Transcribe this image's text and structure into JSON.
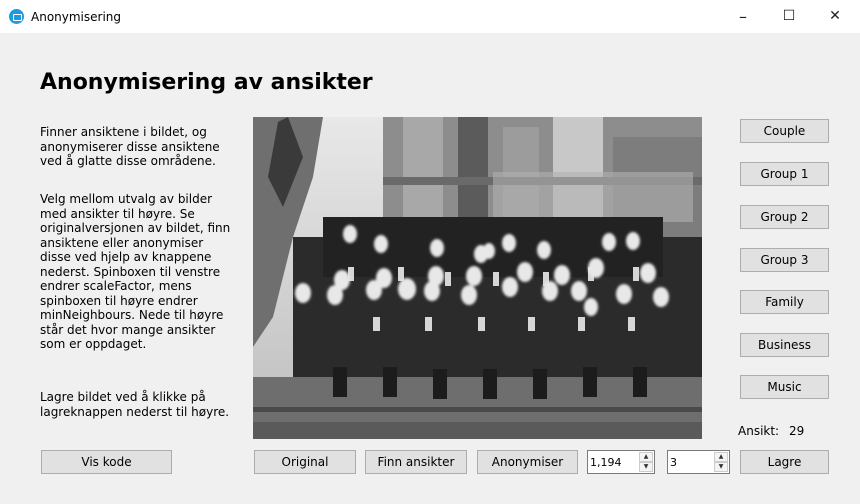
{
  "window": {
    "title": "Anonymisering",
    "minimize": "–",
    "maximize": "☐",
    "close": "✕"
  },
  "heading": "Anonymisering av ansikter",
  "description": [
    "Finner ansiktene i bildet, og anonymiserer disse ansiktene ved å glatte disse områdene.",
    "Velg mellom utvalg av bilder med ansikter til høyre. Se originalversjonen av bildet, finn ansiktene eller anonymiser disse ved hjelp av knappene nederst. Spinboxen til venstre endrer scaleFactor, mens spinboxen til høyre endrer minNeighbours. Nede til høyre står det hvor mange ansikter som er oppdaget.",
    "Lagre bildet ved å klikke på lagreknappen nederst til høyre."
  ],
  "image_buttons": [
    "Couple",
    "Group 1",
    "Group 2",
    "Group 3",
    "Family",
    "Business",
    "Music"
  ],
  "bottom": {
    "show_code": "Vis kode",
    "original": "Original",
    "find_faces": "Finn ansikter",
    "anonymize": "Anonymiser",
    "scale_factor": "1,194",
    "min_neighbours": "3",
    "save": "Lagre"
  },
  "faces": {
    "label": "Ansikt:",
    "count": "29"
  },
  "colors": {
    "window_bg": "#f0f0f0",
    "button_bg": "#e1e1e1",
    "button_border": "#adadad",
    "app_icon": "#1e9be0"
  }
}
